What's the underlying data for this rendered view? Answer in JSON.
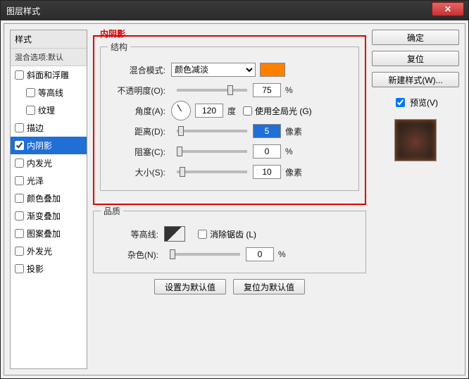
{
  "window": {
    "title": "图层样式"
  },
  "close_glyph": "✕",
  "sidebar": {
    "head": "样式",
    "sub": "混合选项:默认",
    "items": [
      {
        "label": "斜面和浮雕",
        "checked": false,
        "indent": false
      },
      {
        "label": "等高线",
        "checked": false,
        "indent": true
      },
      {
        "label": "纹理",
        "checked": false,
        "indent": true
      },
      {
        "label": "描边",
        "checked": false,
        "indent": false
      },
      {
        "label": "内阴影",
        "checked": true,
        "indent": false,
        "selected": true
      },
      {
        "label": "内发光",
        "checked": false,
        "indent": false
      },
      {
        "label": "光泽",
        "checked": false,
        "indent": false
      },
      {
        "label": "颜色叠加",
        "checked": false,
        "indent": false
      },
      {
        "label": "渐变叠加",
        "checked": false,
        "indent": false
      },
      {
        "label": "图案叠加",
        "checked": false,
        "indent": false
      },
      {
        "label": "外发光",
        "checked": false,
        "indent": false
      },
      {
        "label": "投影",
        "checked": false,
        "indent": false
      }
    ]
  },
  "panel": {
    "heading": "内阴影",
    "section_struct": "结构",
    "section_quality": "品质",
    "blend_mode_label": "混合模式:",
    "blend_mode_value": "颜色减淡",
    "swatch_color": "#ff7f00",
    "opacity_label": "不透明度(O):",
    "opacity_value": "75",
    "opacity_unit": "%",
    "angle_label": "角度(A):",
    "angle_value": "120",
    "angle_unit": "度",
    "global_light_label": "使用全局光 (G)",
    "global_light_checked": false,
    "distance_label": "距离(D):",
    "distance_value": "5",
    "distance_unit": "像素",
    "choke_label": "阻塞(C):",
    "choke_value": "0",
    "choke_unit": "%",
    "size_label": "大小(S):",
    "size_value": "10",
    "size_unit": "像素",
    "contour_label": "等高线:",
    "antialias_label": "消除锯齿 (L)",
    "antialias_checked": false,
    "noise_label": "杂色(N):",
    "noise_value": "0",
    "noise_unit": "%",
    "set_default": "设置为默认值",
    "reset_default": "复位为默认值"
  },
  "right": {
    "ok": "确定",
    "cancel": "复位",
    "new_style": "新建样式(W)...",
    "preview_label": "预览(V)",
    "preview_checked": true
  }
}
